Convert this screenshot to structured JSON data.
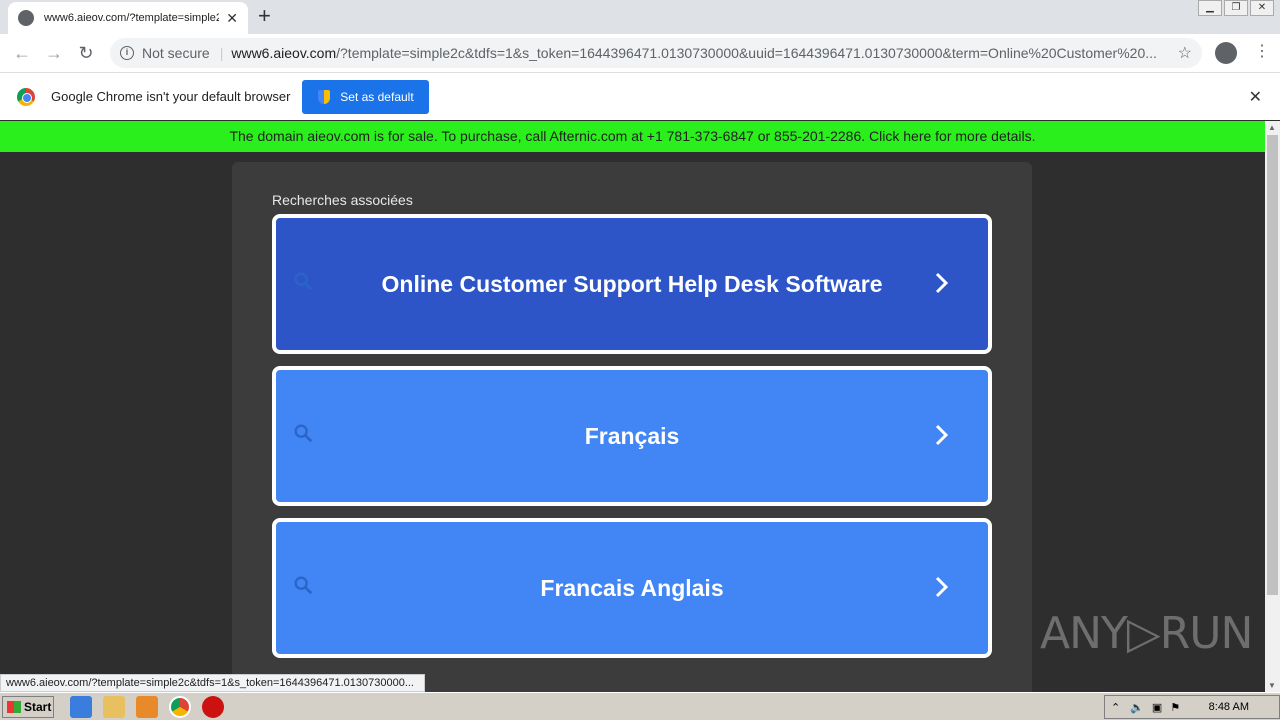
{
  "browser": {
    "tab_title": "www6.aieov.com/?template=simple2",
    "new_tab": "+",
    "not_secure": "Not secure",
    "url_host": "www6.aieov.com",
    "url_rest": "/?template=simple2c&tdfs=1&s_token=1644396471.0130730000&uuid=1644396471.0130730000&term=Online%20Customer%20...",
    "infobar_message": "Google Chrome isn't your default browser",
    "set_default_label": "Set as default",
    "status_url": "www6.aieov.com/?template=simple2c&tdfs=1&s_token=1644396471.0130730000..."
  },
  "page": {
    "sale_banner": "The domain aieov.com is for sale. To purchase, call Afternic.com at +1 781-373-6847 or 855-201-2286. Click here for more details.",
    "related_heading": "Recherches associées",
    "links": [
      {
        "label": "Online Customer Support Help Desk Software",
        "color": "#2d55c8"
      },
      {
        "label": "Français",
        "color": "#4285f4"
      },
      {
        "label": "Francais Anglais",
        "color": "#4285f4"
      }
    ]
  },
  "watermark": "ANY▷RUN",
  "taskbar": {
    "start_label": "Start",
    "clock": "8:48 AM"
  }
}
